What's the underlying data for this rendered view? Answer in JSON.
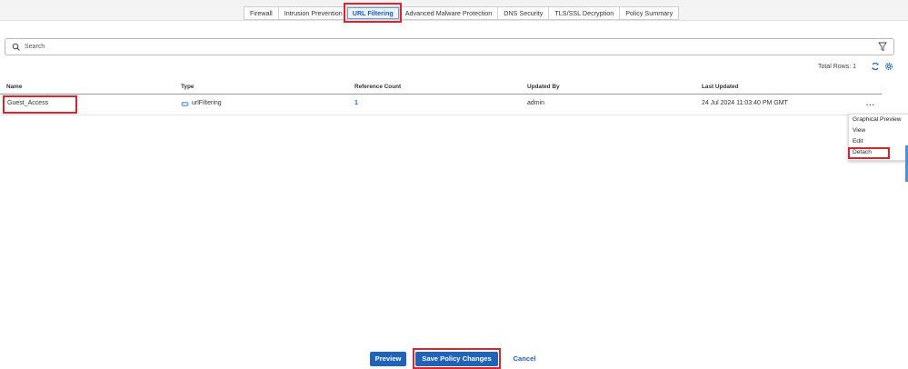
{
  "tabs": [
    {
      "label": "Firewall"
    },
    {
      "label": "Intrusion Prevention"
    },
    {
      "label": "URL Filtering"
    },
    {
      "label": "Advanced Malware Protection"
    },
    {
      "label": "DNS Security"
    },
    {
      "label": "TLS/SSL Decryption"
    },
    {
      "label": "Policy Summary"
    }
  ],
  "search": {
    "placeholder": "Search"
  },
  "table": {
    "total_rows": "Total Rows: 1",
    "columns": [
      "Name",
      "Type",
      "Reference Count",
      "Updated By",
      "Last Updated"
    ],
    "rows": [
      {
        "name": "Guest_Access",
        "type": "urlFiltering",
        "reference_count": "1",
        "updated_by": "admin",
        "last_updated": "24 Jul 2024 11:03:40 PM GMT",
        "more": "..."
      }
    ]
  },
  "context_menu": {
    "items": [
      "Graphical Preview",
      "View",
      "Edit",
      "Detach"
    ]
  },
  "footer": {
    "preview": "Preview",
    "save": "Save Policy Changes",
    "cancel": "Cancel"
  },
  "colors": {
    "accent": "#1f64b9",
    "highlight": "#d9262e"
  }
}
